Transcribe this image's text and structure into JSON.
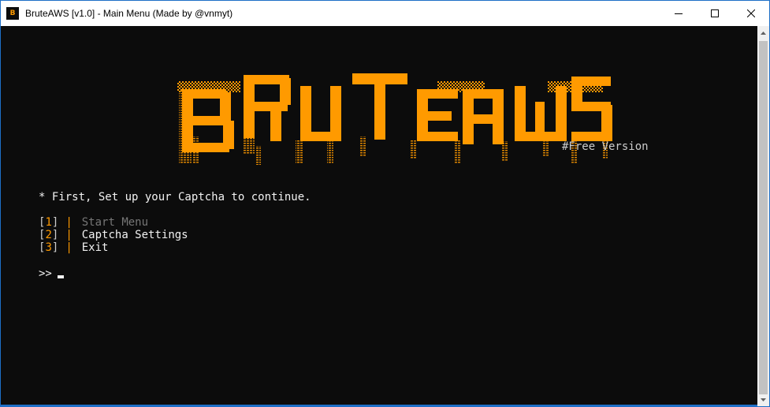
{
  "window": {
    "title": "BruteAWS [v1.0] - Main Menu (Made by @vnmyt)",
    "app_icon_glyph": "B",
    "icons": [
      "app-icon",
      "minimize-icon",
      "maximize-icon",
      "close-icon",
      "scroll-up-icon",
      "scroll-down-icon"
    ]
  },
  "banner": {
    "logo_text": "BRUTEAWS",
    "tag": "#Free Version",
    "color": "#ff9a00"
  },
  "console": {
    "notice": "* First, Set up your Captcha to continue.",
    "menu": [
      {
        "number": "1",
        "label": "Start Menu",
        "enabled": false
      },
      {
        "number": "2",
        "label": "Captcha Settings",
        "enabled": true
      },
      {
        "number": "3",
        "label": "Exit",
        "enabled": true
      }
    ],
    "prompt": ">>"
  },
  "colors": {
    "background": "#0c0c0c",
    "accent": "#ff9a00",
    "text": "#f2f2f2",
    "muted": "#767676",
    "window_border": "#1e6fc7"
  }
}
